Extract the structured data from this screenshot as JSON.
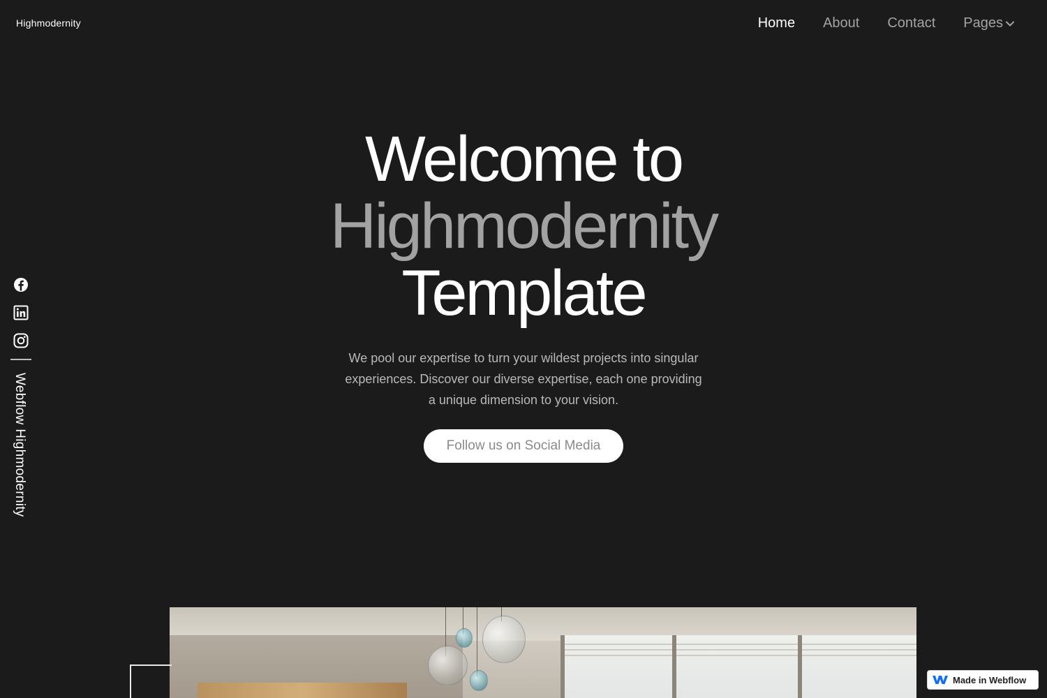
{
  "brand": {
    "name": "Highmodernity"
  },
  "nav": {
    "items": [
      {
        "label": "Home",
        "active": true
      },
      {
        "label": "About",
        "active": false
      },
      {
        "label": "Contact",
        "active": false
      },
      {
        "label": "Pages",
        "active": false,
        "dropdown": true
      }
    ]
  },
  "hero": {
    "title_line1": "Welcome to",
    "title_line2": "Highmodernity",
    "title_line3": "Template",
    "description": "We pool our expertise to turn your wildest projects into singular experiences. Discover our diverse expertise, each one providing a unique dimension to your vision.",
    "cta_label": "Follow us on Social Media"
  },
  "social": {
    "icons": [
      "facebook-icon",
      "linkedin-icon",
      "instagram-icon"
    ],
    "vertical_label": "Webflow Highmodernity"
  },
  "badge": {
    "label": "Made in Webflow"
  },
  "colors": {
    "background": "#1b1b1c",
    "heading": "#ffffff",
    "heading_muted": "#a2a2a2",
    "nav_inactive": "#a3a3a3",
    "body_text": "#b9b9b9",
    "button_bg": "#ffffff",
    "webflow_blue": "#146ef5"
  }
}
